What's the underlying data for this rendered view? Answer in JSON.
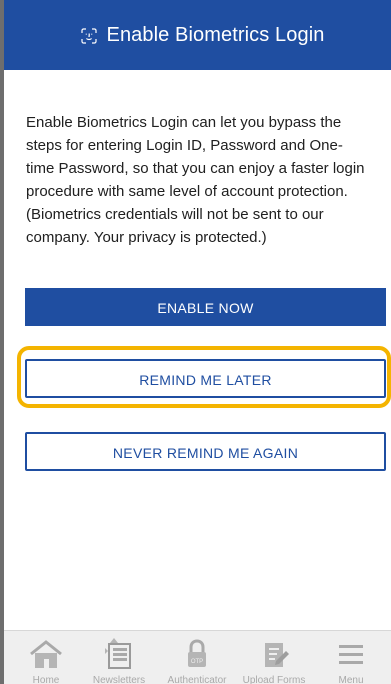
{
  "header": {
    "title": "Enable Biometrics Login",
    "icon": "face-id-icon",
    "background": "#1f4ea1"
  },
  "content": {
    "description": "Enable Biometrics Login can let you bypass the steps for entering Login ID, Password and One-time Password, so that you can enjoy a faster login procedure with same level of account protection. (Biometrics credentials will not be sent to our company. Your privacy is protected.)"
  },
  "buttons": {
    "enable_now": "ENABLE NOW",
    "remind_later": "REMIND ME LATER",
    "never_remind": "NEVER REMIND ME AGAIN",
    "primary_color": "#1f4ea1",
    "highlight_color": "#f4b400"
  },
  "tabs": [
    {
      "label": "Home",
      "icon": "home-icon"
    },
    {
      "label": "Newsletters",
      "icon": "newsletters-icon"
    },
    {
      "label": "Authenticator",
      "icon": "otp-lock-icon"
    },
    {
      "label": "Upload Forms",
      "icon": "upload-forms-icon"
    },
    {
      "label": "Menu",
      "icon": "menu-icon"
    }
  ]
}
